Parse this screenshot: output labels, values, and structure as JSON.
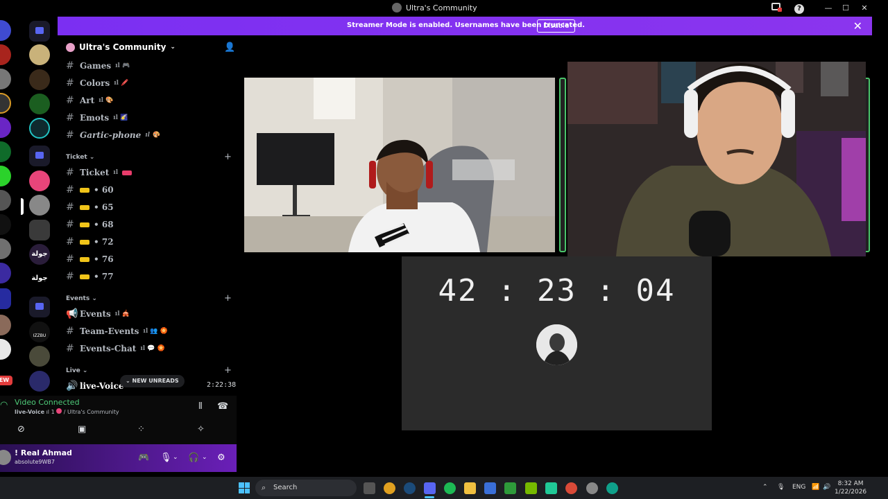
{
  "window": {
    "title": "Ultra's Community"
  },
  "banner": {
    "message": "Streamer Mode is enabled. Usernames have been truncated.",
    "disable_label": "Disable"
  },
  "guild": {
    "name": "Ultra's Community"
  },
  "channels": [
    {
      "name": "Games",
      "suffix": "ıl 🎮"
    },
    {
      "name": "Colors",
      "suffix": "ıl 🖍️"
    },
    {
      "name": "Art",
      "suffix": "ıl 🎨"
    },
    {
      "name": "Emots",
      "suffix": "ıl 🌠"
    },
    {
      "name": "Gartic-phone",
      "suffix": "ıl 🎨"
    }
  ],
  "categories": {
    "ticket": "Ticket",
    "events": "Events",
    "live": "Live"
  },
  "ticket_channels": [
    {
      "name": "Ticket",
      "suffix": "ıl"
    },
    {
      "name": "• 60"
    },
    {
      "name": "• 65"
    },
    {
      "name": "• 68"
    },
    {
      "name": "• 72"
    },
    {
      "name": "• 76"
    },
    {
      "name": "• 77"
    }
  ],
  "event_channels": [
    {
      "name": "Events",
      "suffix": "ıl 🎪"
    },
    {
      "name": "Team-Events",
      "suffix": "ıl 👥 🏵️"
    },
    {
      "name": "Events-Chat",
      "suffix": "ıl 💬 🏵️"
    }
  ],
  "live_channels": [
    {
      "name": "live-Voice",
      "time": "2:22:38"
    }
  ],
  "new_unreads_label": "NEW UNREADS",
  "server_labels": {
    "jawla1": "جولة",
    "jawla2": "جولة",
    "new": "EW",
    "izzbu": "IZZBU"
  },
  "voice": {
    "status": "Video Connected",
    "channel": "live-Voice",
    "count": "ıl 1",
    "guild": "/ Ultra's Community"
  },
  "user": {
    "name": "! Real Ahmad",
    "tag": "absolute9WB7"
  },
  "timer": {
    "display": "42 : 23 : 04"
  },
  "taskbar": {
    "search_placeholder": "Search",
    "lang": "ENG",
    "time": "8:32 AM",
    "date": "1/22/2026"
  }
}
